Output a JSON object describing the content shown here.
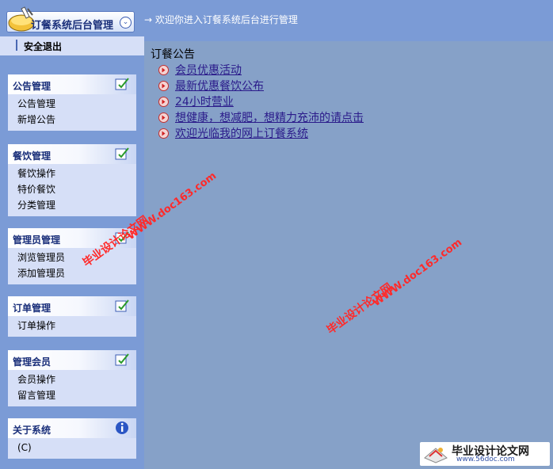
{
  "header": {
    "app_title": "订餐系统后台管理",
    "welcome": "→ 欢迎你进入订餐系统后台进行管理"
  },
  "sidebar": {
    "logout": "安全退出",
    "groups": [
      {
        "title": "公告管理",
        "icon": "edit-icon",
        "items": [
          "公告管理",
          "新增公告"
        ]
      },
      {
        "title": "餐饮管理",
        "icon": "edit-icon",
        "items": [
          "餐饮操作",
          "特价餐饮",
          "分类管理"
        ]
      },
      {
        "title": "管理员管理",
        "icon": "edit-icon",
        "items": [
          "浏览管理员",
          "添加管理员"
        ]
      },
      {
        "title": "订单管理",
        "icon": "edit-icon",
        "items": [
          "订单操作"
        ]
      },
      {
        "title": "管理会员",
        "icon": "edit-icon",
        "items": [
          "会员操作",
          "留言管理"
        ]
      },
      {
        "title": "关于系统",
        "icon": "info-icon",
        "items": [
          "(C)"
        ]
      }
    ]
  },
  "main": {
    "title": "订餐公告",
    "notices": [
      "会员优惠活动",
      "最新优惠餐饮公布",
      "24小时营业",
      "想健康，想减肥，想精力充沛的请点击",
      "欢迎光临我的网上订餐系统"
    ]
  },
  "watermarks": {
    "cn": "毕业设计论文网",
    "url": "WWW.doc163.com",
    "corner_cn": "毕业设计论文网",
    "corner_url": "www.56doc.com"
  },
  "colors": {
    "background": "#7b9bd6",
    "main_panel": "#86a1c8",
    "sidebar_group": "#d6dff7",
    "link": "#2a1a8a",
    "watermark": "#ff2a2a"
  }
}
